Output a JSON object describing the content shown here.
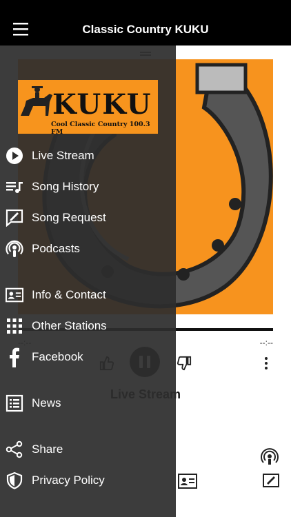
{
  "header": {
    "title": "Classic Country KUKU",
    "menu_icon": "hamburger-icon"
  },
  "logo": {
    "name": "KUKU",
    "tagline": "Cool Classic Country 100.3 FM"
  },
  "drawer": {
    "items": [
      {
        "label": "Live Stream",
        "icon": "play-circle-icon"
      },
      {
        "label": "Song History",
        "icon": "playlist-icon"
      },
      {
        "label": "Song Request",
        "icon": "request-icon"
      },
      {
        "label": "Podcasts",
        "icon": "podcast-icon"
      },
      {
        "label": "Info & Contact",
        "icon": "contact-card-icon"
      },
      {
        "label": "Other Stations",
        "icon": "grid-icon"
      },
      {
        "label": "Facebook",
        "icon": "facebook-icon"
      },
      {
        "label": "News",
        "icon": "news-icon"
      },
      {
        "label": "Share",
        "icon": "share-icon"
      },
      {
        "label": "Privacy Policy",
        "icon": "shield-icon"
      }
    ]
  },
  "player": {
    "elapsed": "--:--",
    "duration": "--:--",
    "now_playing": "Live Stream"
  },
  "colors": {
    "accent": "#f7931e",
    "drawer_bg": "#2d2d2d",
    "header_bg": "#000000"
  }
}
